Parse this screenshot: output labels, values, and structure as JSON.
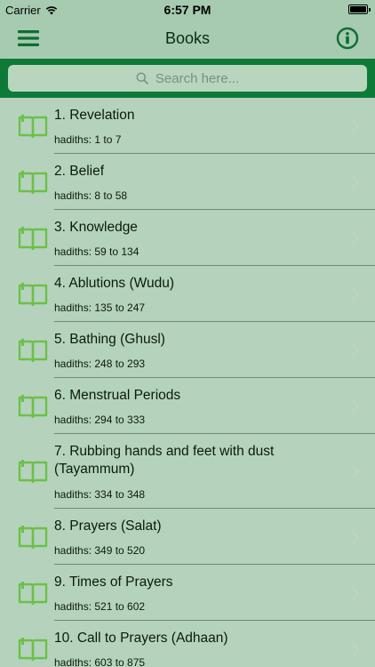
{
  "status_bar": {
    "carrier": "Carrier",
    "time": "6:57 PM"
  },
  "nav": {
    "title": "Books",
    "menu_icon": "hamburger-menu-icon",
    "info_icon": "info-circle-icon"
  },
  "search": {
    "placeholder": "Search here...",
    "icon": "search-icon"
  },
  "colors": {
    "background": "#b5d3bc",
    "nav_bar": "#a6cbb0",
    "search_bar": "#0d7a38",
    "accent_green": "#6cc04a",
    "icon_dark_green": "#0d6e32"
  },
  "books": [
    {
      "name": "1. Revelation",
      "hadiths": "hadiths: 1 to 7"
    },
    {
      "name": "2. Belief",
      "hadiths": "hadiths: 8 to 58"
    },
    {
      "name": "3. Knowledge",
      "hadiths": "hadiths: 59 to 134"
    },
    {
      "name": "4. Ablutions (Wudu)",
      "hadiths": "hadiths: 135 to 247"
    },
    {
      "name": "5. Bathing (Ghusl)",
      "hadiths": "hadiths: 248 to 293"
    },
    {
      "name": "6. Menstrual Periods",
      "hadiths": "hadiths: 294 to 333"
    },
    {
      "name": "7. Rubbing hands and feet with dust (Tayammum)",
      "hadiths": "hadiths: 334 to 348"
    },
    {
      "name": "8. Prayers (Salat)",
      "hadiths": "hadiths: 349 to 520"
    },
    {
      "name": "9. Times of Prayers",
      "hadiths": "hadiths: 521 to 602"
    },
    {
      "name": "10. Call to Prayers (Adhaan)",
      "hadiths": "hadiths: 603 to 875"
    }
  ]
}
